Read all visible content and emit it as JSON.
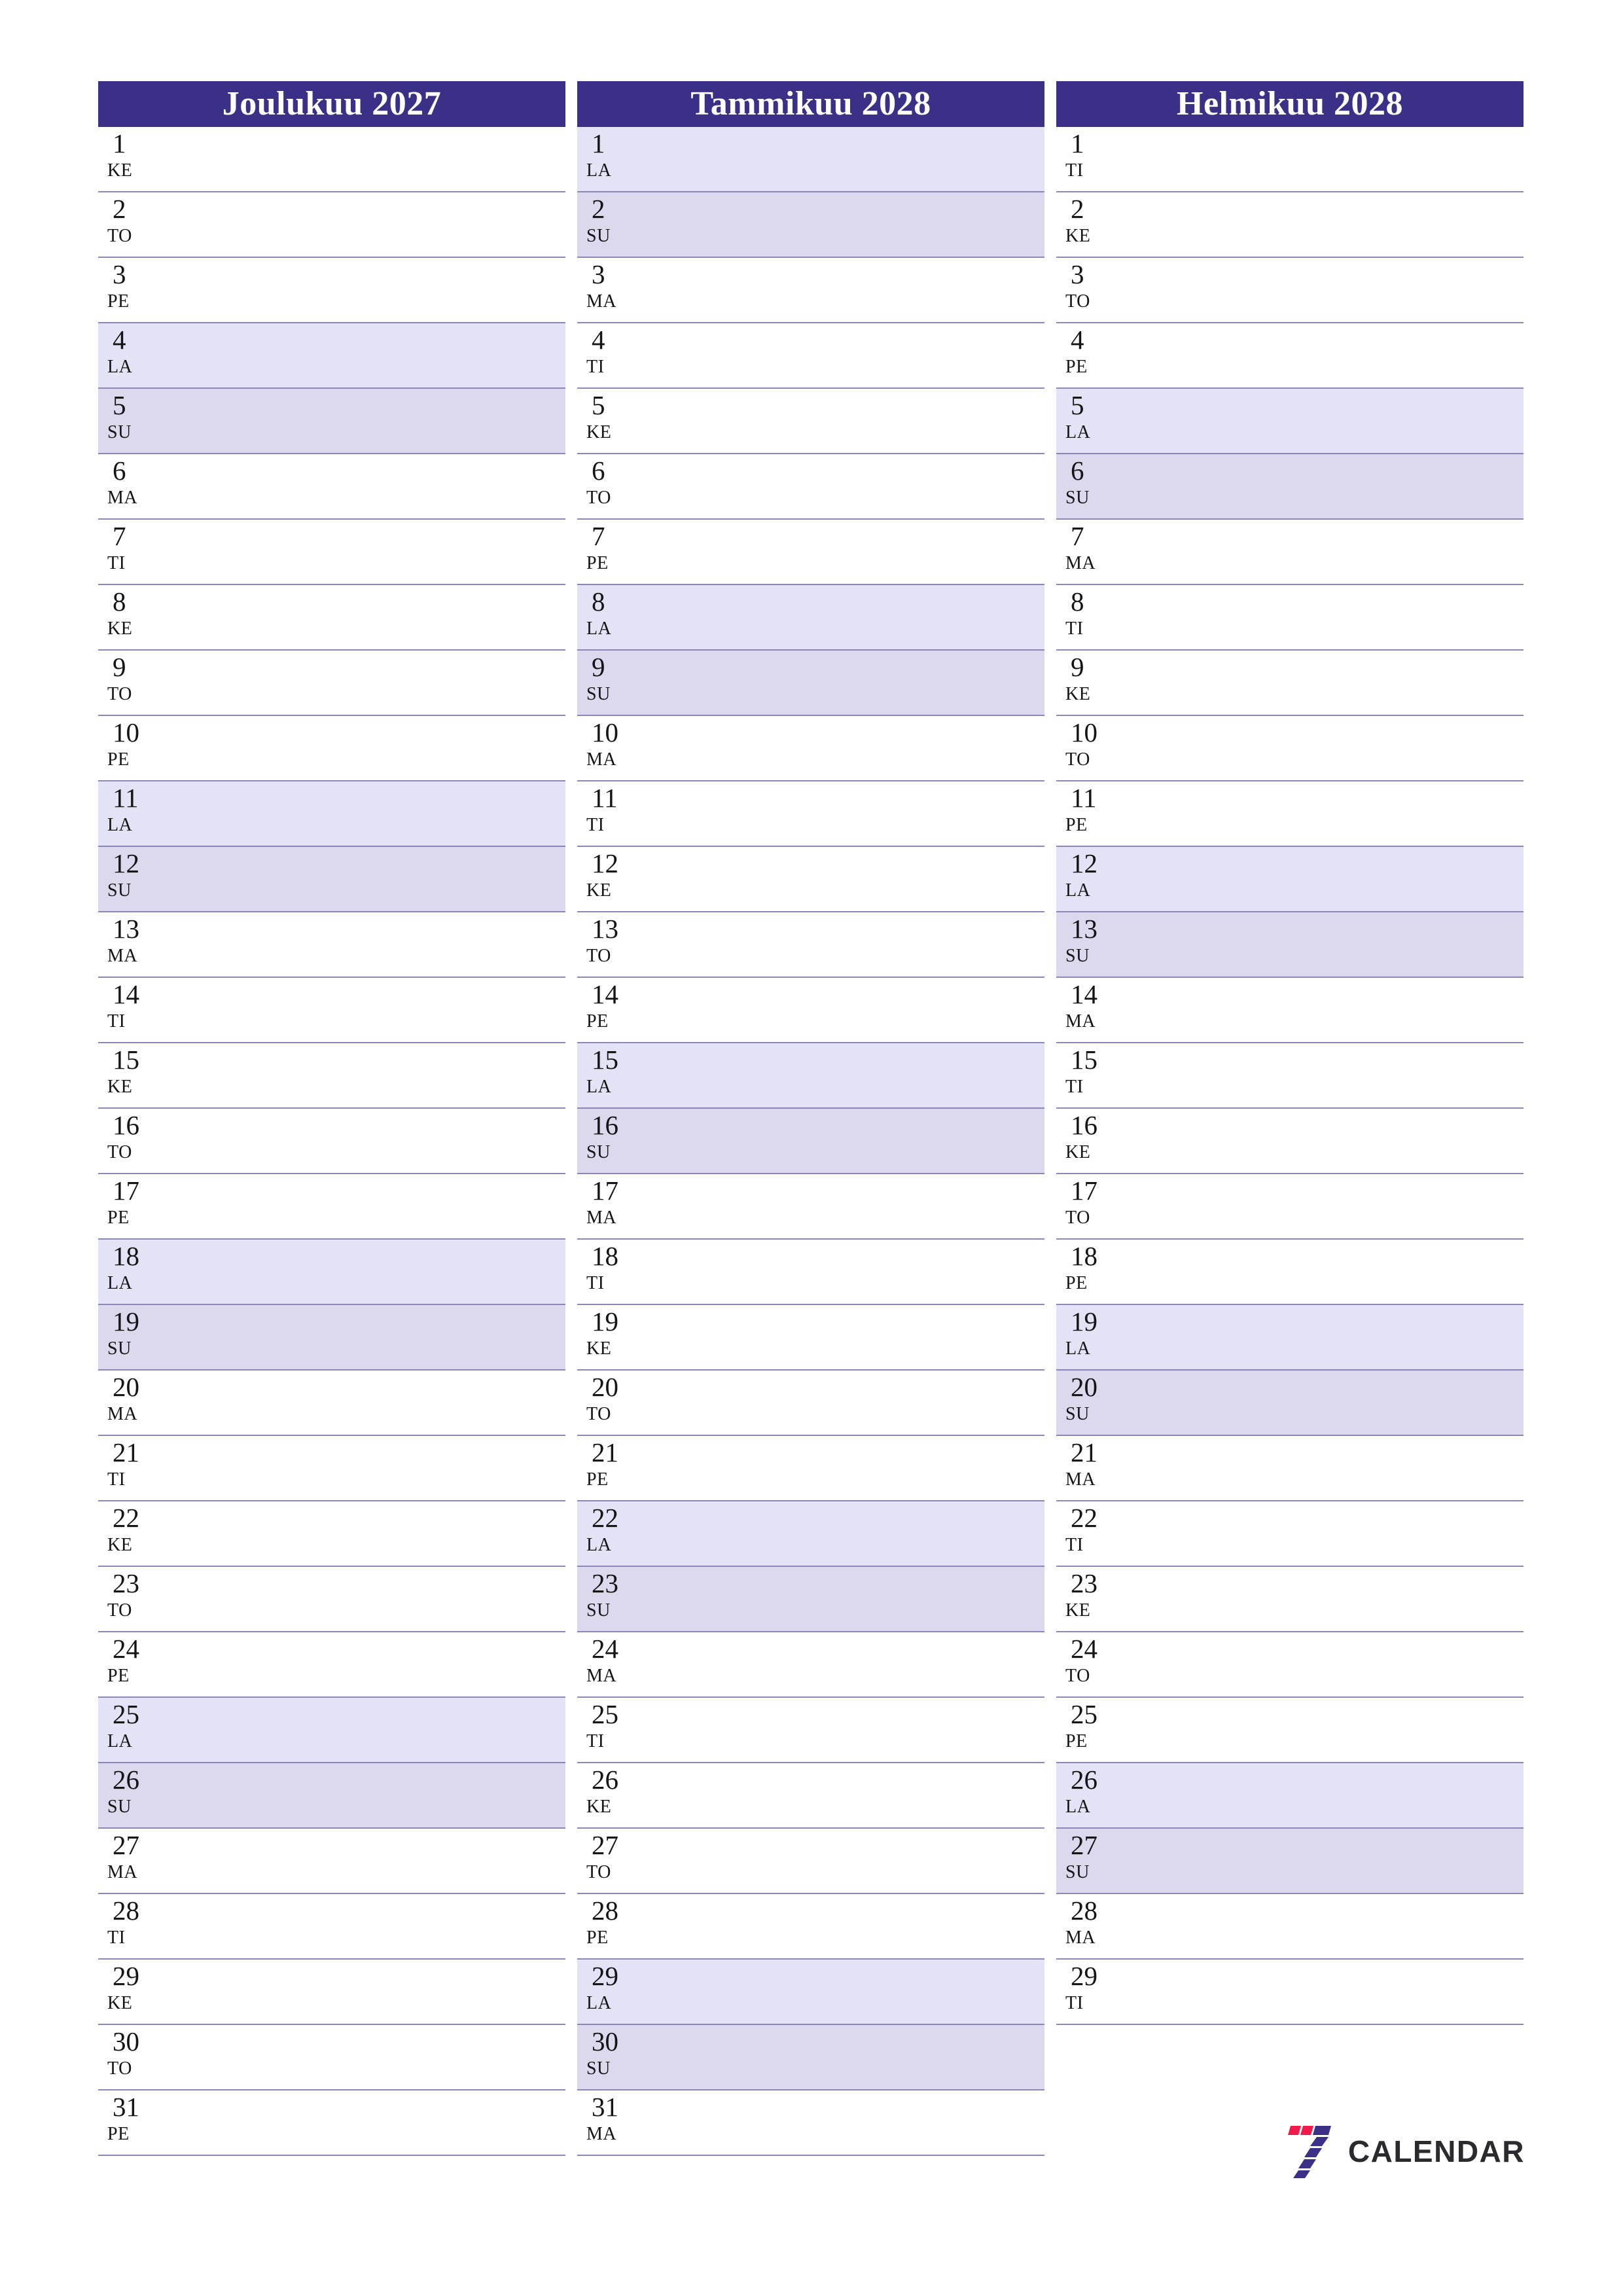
{
  "page": {
    "background": "#ffffff",
    "accent_header_bg": "#3b3087",
    "accent_header_text": "#ffffff",
    "saturday_bg": "#e3e2f7",
    "sunday_bg": "#dcd8ee",
    "row_separator": "#8b87b8",
    "day_text": "#151515"
  },
  "brand": {
    "name": "CALENDAR",
    "mark_red": "#f4194b",
    "mark_blue": "#3b3087",
    "text_color": "#2b2b2f"
  },
  "months": [
    {
      "title": "Joulukuu 2027",
      "days": [
        {
          "num": "1",
          "abbr": "KE",
          "kind": "weekday"
        },
        {
          "num": "2",
          "abbr": "TO",
          "kind": "weekday"
        },
        {
          "num": "3",
          "abbr": "PE",
          "kind": "weekday"
        },
        {
          "num": "4",
          "abbr": "LA",
          "kind": "sat"
        },
        {
          "num": "5",
          "abbr": "SU",
          "kind": "sun"
        },
        {
          "num": "6",
          "abbr": "MA",
          "kind": "weekday"
        },
        {
          "num": "7",
          "abbr": "TI",
          "kind": "weekday"
        },
        {
          "num": "8",
          "abbr": "KE",
          "kind": "weekday"
        },
        {
          "num": "9",
          "abbr": "TO",
          "kind": "weekday"
        },
        {
          "num": "10",
          "abbr": "PE",
          "kind": "weekday"
        },
        {
          "num": "11",
          "abbr": "LA",
          "kind": "sat"
        },
        {
          "num": "12",
          "abbr": "SU",
          "kind": "sun"
        },
        {
          "num": "13",
          "abbr": "MA",
          "kind": "weekday"
        },
        {
          "num": "14",
          "abbr": "TI",
          "kind": "weekday"
        },
        {
          "num": "15",
          "abbr": "KE",
          "kind": "weekday"
        },
        {
          "num": "16",
          "abbr": "TO",
          "kind": "weekday"
        },
        {
          "num": "17",
          "abbr": "PE",
          "kind": "weekday"
        },
        {
          "num": "18",
          "abbr": "LA",
          "kind": "sat"
        },
        {
          "num": "19",
          "abbr": "SU",
          "kind": "sun"
        },
        {
          "num": "20",
          "abbr": "MA",
          "kind": "weekday"
        },
        {
          "num": "21",
          "abbr": "TI",
          "kind": "weekday"
        },
        {
          "num": "22",
          "abbr": "KE",
          "kind": "weekday"
        },
        {
          "num": "23",
          "abbr": "TO",
          "kind": "weekday"
        },
        {
          "num": "24",
          "abbr": "PE",
          "kind": "weekday"
        },
        {
          "num": "25",
          "abbr": "LA",
          "kind": "sat"
        },
        {
          "num": "26",
          "abbr": "SU",
          "kind": "sun"
        },
        {
          "num": "27",
          "abbr": "MA",
          "kind": "weekday"
        },
        {
          "num": "28",
          "abbr": "TI",
          "kind": "weekday"
        },
        {
          "num": "29",
          "abbr": "KE",
          "kind": "weekday"
        },
        {
          "num": "30",
          "abbr": "TO",
          "kind": "weekday"
        },
        {
          "num": "31",
          "abbr": "PE",
          "kind": "weekday"
        }
      ]
    },
    {
      "title": "Tammikuu 2028",
      "days": [
        {
          "num": "1",
          "abbr": "LA",
          "kind": "sat"
        },
        {
          "num": "2",
          "abbr": "SU",
          "kind": "sun"
        },
        {
          "num": "3",
          "abbr": "MA",
          "kind": "weekday"
        },
        {
          "num": "4",
          "abbr": "TI",
          "kind": "weekday"
        },
        {
          "num": "5",
          "abbr": "KE",
          "kind": "weekday"
        },
        {
          "num": "6",
          "abbr": "TO",
          "kind": "weekday"
        },
        {
          "num": "7",
          "abbr": "PE",
          "kind": "weekday"
        },
        {
          "num": "8",
          "abbr": "LA",
          "kind": "sat"
        },
        {
          "num": "9",
          "abbr": "SU",
          "kind": "sun"
        },
        {
          "num": "10",
          "abbr": "MA",
          "kind": "weekday"
        },
        {
          "num": "11",
          "abbr": "TI",
          "kind": "weekday"
        },
        {
          "num": "12",
          "abbr": "KE",
          "kind": "weekday"
        },
        {
          "num": "13",
          "abbr": "TO",
          "kind": "weekday"
        },
        {
          "num": "14",
          "abbr": "PE",
          "kind": "weekday"
        },
        {
          "num": "15",
          "abbr": "LA",
          "kind": "sat"
        },
        {
          "num": "16",
          "abbr": "SU",
          "kind": "sun"
        },
        {
          "num": "17",
          "abbr": "MA",
          "kind": "weekday"
        },
        {
          "num": "18",
          "abbr": "TI",
          "kind": "weekday"
        },
        {
          "num": "19",
          "abbr": "KE",
          "kind": "weekday"
        },
        {
          "num": "20",
          "abbr": "TO",
          "kind": "weekday"
        },
        {
          "num": "21",
          "abbr": "PE",
          "kind": "weekday"
        },
        {
          "num": "22",
          "abbr": "LA",
          "kind": "sat"
        },
        {
          "num": "23",
          "abbr": "SU",
          "kind": "sun"
        },
        {
          "num": "24",
          "abbr": "MA",
          "kind": "weekday"
        },
        {
          "num": "25",
          "abbr": "TI",
          "kind": "weekday"
        },
        {
          "num": "26",
          "abbr": "KE",
          "kind": "weekday"
        },
        {
          "num": "27",
          "abbr": "TO",
          "kind": "weekday"
        },
        {
          "num": "28",
          "abbr": "PE",
          "kind": "weekday"
        },
        {
          "num": "29",
          "abbr": "LA",
          "kind": "sat"
        },
        {
          "num": "30",
          "abbr": "SU",
          "kind": "sun"
        },
        {
          "num": "31",
          "abbr": "MA",
          "kind": "weekday"
        }
      ]
    },
    {
      "title": "Helmikuu 2028",
      "days": [
        {
          "num": "1",
          "abbr": "TI",
          "kind": "weekday"
        },
        {
          "num": "2",
          "abbr": "KE",
          "kind": "weekday"
        },
        {
          "num": "3",
          "abbr": "TO",
          "kind": "weekday"
        },
        {
          "num": "4",
          "abbr": "PE",
          "kind": "weekday"
        },
        {
          "num": "5",
          "abbr": "LA",
          "kind": "sat"
        },
        {
          "num": "6",
          "abbr": "SU",
          "kind": "sun"
        },
        {
          "num": "7",
          "abbr": "MA",
          "kind": "weekday"
        },
        {
          "num": "8",
          "abbr": "TI",
          "kind": "weekday"
        },
        {
          "num": "9",
          "abbr": "KE",
          "kind": "weekday"
        },
        {
          "num": "10",
          "abbr": "TO",
          "kind": "weekday"
        },
        {
          "num": "11",
          "abbr": "PE",
          "kind": "weekday"
        },
        {
          "num": "12",
          "abbr": "LA",
          "kind": "sat"
        },
        {
          "num": "13",
          "abbr": "SU",
          "kind": "sun"
        },
        {
          "num": "14",
          "abbr": "MA",
          "kind": "weekday"
        },
        {
          "num": "15",
          "abbr": "TI",
          "kind": "weekday"
        },
        {
          "num": "16",
          "abbr": "KE",
          "kind": "weekday"
        },
        {
          "num": "17",
          "abbr": "TO",
          "kind": "weekday"
        },
        {
          "num": "18",
          "abbr": "PE",
          "kind": "weekday"
        },
        {
          "num": "19",
          "abbr": "LA",
          "kind": "sat"
        },
        {
          "num": "20",
          "abbr": "SU",
          "kind": "sun"
        },
        {
          "num": "21",
          "abbr": "MA",
          "kind": "weekday"
        },
        {
          "num": "22",
          "abbr": "TI",
          "kind": "weekday"
        },
        {
          "num": "23",
          "abbr": "KE",
          "kind": "weekday"
        },
        {
          "num": "24",
          "abbr": "TO",
          "kind": "weekday"
        },
        {
          "num": "25",
          "abbr": "PE",
          "kind": "weekday"
        },
        {
          "num": "26",
          "abbr": "LA",
          "kind": "sat"
        },
        {
          "num": "27",
          "abbr": "SU",
          "kind": "sun"
        },
        {
          "num": "28",
          "abbr": "MA",
          "kind": "weekday"
        },
        {
          "num": "29",
          "abbr": "TI",
          "kind": "weekday"
        }
      ]
    }
  ]
}
